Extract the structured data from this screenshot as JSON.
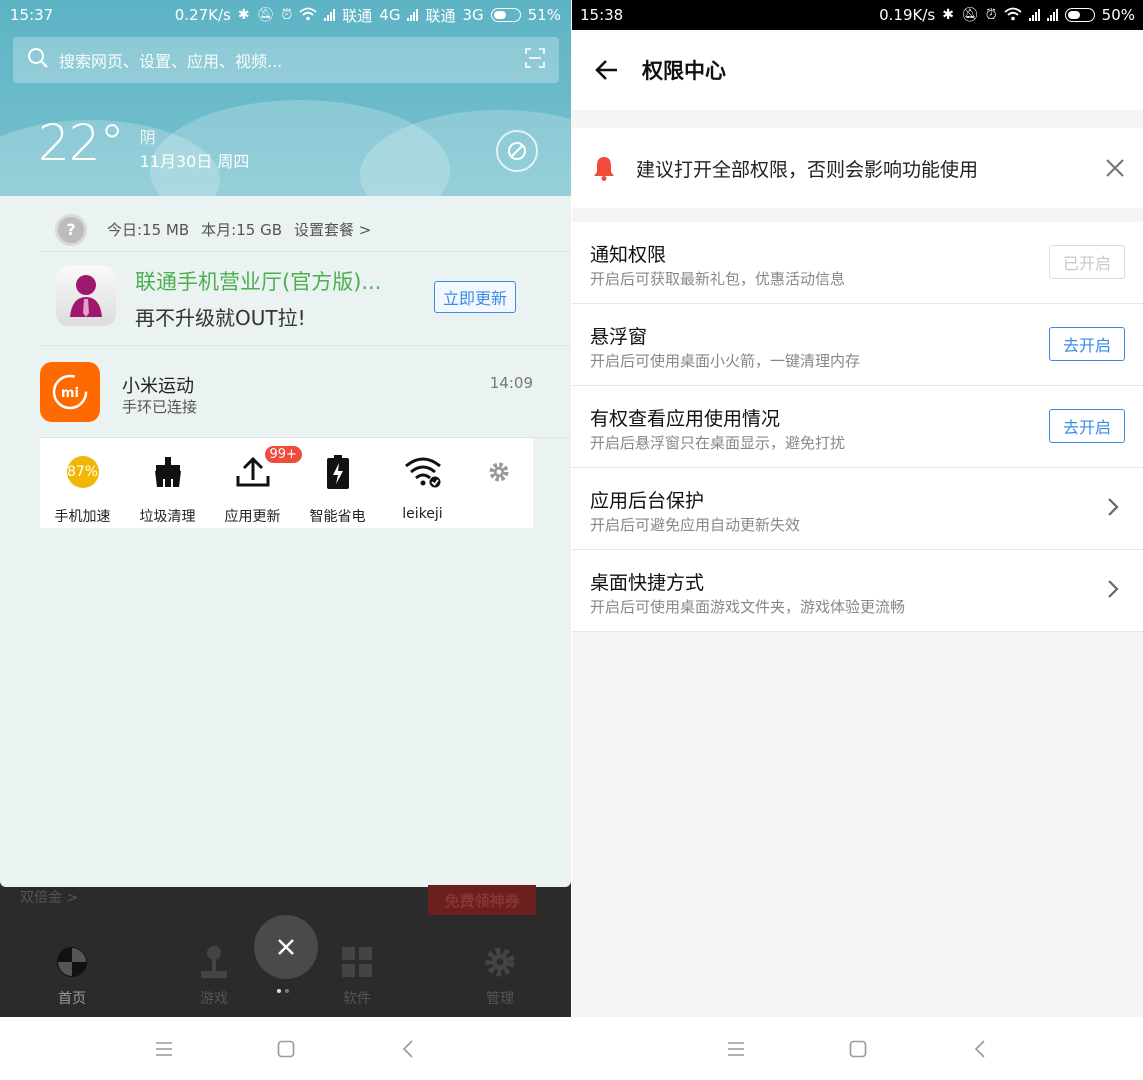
{
  "left": {
    "status": {
      "time": "15:37",
      "speed": "0.27K/s",
      "carrier1": "联通",
      "net1": "4G",
      "carrier2": "联通",
      "net2": "3G",
      "battery": "51%",
      "battery_level": 0.51
    },
    "search": {
      "placeholder": "搜索网页、设置、应用、视频..."
    },
    "weather": {
      "temp": "22°",
      "condition": "阴",
      "date": "11月30日 周四"
    },
    "data_usage": {
      "today": "今日:15 MB",
      "month": "本月:15 GB",
      "plan_link": "设置套餐 >"
    },
    "notifications": [
      {
        "title": "联通手机营业厅(官方版)...",
        "subtitle": "再不升级就OUT拉!",
        "button": "立即更新"
      },
      {
        "title": "小米运动",
        "subtitle": "手环已连接",
        "time": "14:09"
      }
    ],
    "toggles": [
      {
        "label": "手机加速",
        "value": "87%"
      },
      {
        "label": "垃圾清理"
      },
      {
        "label": "应用更新",
        "badge": "99+"
      },
      {
        "label": "智能省电"
      },
      {
        "label": "leikeji"
      }
    ],
    "behind": {
      "link": "双倍金 >",
      "banner": "免费领神券"
    },
    "nav_tabs": [
      "首页",
      "游戏",
      "软件",
      "管理"
    ]
  },
  "right": {
    "status": {
      "time": "15:38",
      "speed": "0.19K/s",
      "battery": "50%",
      "battery_level": 0.5
    },
    "title": "权限中心",
    "warning": "建议打开全部权限，否则会影响功能使用",
    "permissions": [
      {
        "title": "通知权限",
        "desc": "开启后可获取最新礼包，优惠活动信息",
        "button": "已开启"
      },
      {
        "title": "悬浮窗",
        "desc": "开启后可使用桌面小火箭，一键清理内存",
        "button": "去开启"
      },
      {
        "title": "有权查看应用使用情况",
        "desc": "开启后悬浮窗只在桌面显示，避免打扰",
        "button": "去开启"
      },
      {
        "title": "应用后台保护",
        "desc": "开启后可避免应用自动更新失效"
      },
      {
        "title": "桌面快捷方式",
        "desc": "开启后可使用桌面游戏文件夹，游戏体验更流畅"
      }
    ]
  },
  "colors": {
    "accent_blue": "#3a8be8",
    "unicom_green": "#4caf50",
    "mi_orange": "#ff6a00",
    "bell_red": "#f04c3c"
  }
}
